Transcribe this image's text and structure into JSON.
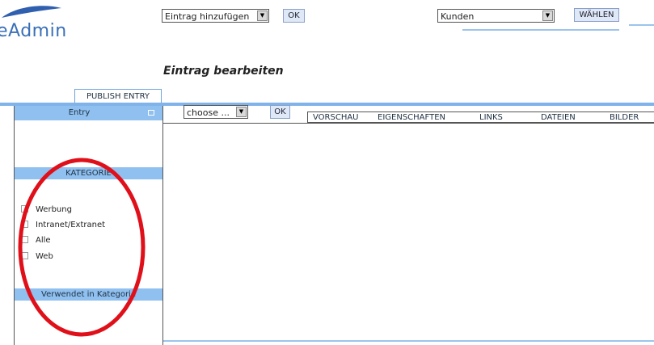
{
  "logo": {
    "text": "eAdmin"
  },
  "header": {
    "action_select": {
      "value": "Eintrag hinzufügen"
    },
    "action_ok": "OK",
    "customer_select": {
      "value": "Kunden"
    },
    "choose_button": "WÄHLEN"
  },
  "page": {
    "heading": "Eintrag bearbeiten"
  },
  "left_panel": {
    "publish_tab": "PUBLISH ENTRY",
    "entry_title": "Entry",
    "category_header": "KATEGORIE",
    "categories": [
      {
        "label": "Werbung",
        "checked": false
      },
      {
        "label": "Intranet/Extranet",
        "checked": false
      },
      {
        "label": "Alle",
        "checked": false
      },
      {
        "label": "Web",
        "checked": false
      }
    ],
    "used_in_header": "Verwendet in Kategorie"
  },
  "right_panel": {
    "choose_select": {
      "value": "choose ..."
    },
    "ok_button": "OK",
    "tabs": [
      "VORSCHAU",
      "EIGENSCHAFTEN",
      "LINKS",
      "DATEIEN",
      "BILDER"
    ]
  },
  "colors": {
    "accent_blue": "#8fc0ef",
    "annotation_red": "#e0101a",
    "logo_blue": "#3a6fb8"
  }
}
